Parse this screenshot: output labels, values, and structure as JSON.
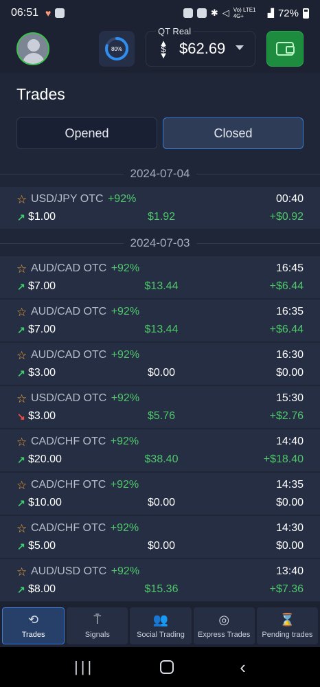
{
  "status_bar": {
    "time": "06:51",
    "battery": "72%",
    "signal_text": "Vo) LTE1 4G+"
  },
  "header": {
    "progress_label": "80%",
    "progress_value": 0.8,
    "account_label": "QT Real",
    "balance": "$62.69"
  },
  "page": {
    "title": "Trades",
    "tabs": {
      "opened": "Opened",
      "closed": "Closed"
    }
  },
  "groups": [
    {
      "date": "2024-07-04",
      "trades": [
        {
          "pair": "USD/JPY OTC",
          "pct": "+92%",
          "time": "00:40",
          "direction": "up",
          "amount": "$1.00",
          "payout": "$1.92",
          "payout_color": "green",
          "profit": "+$0.92",
          "profit_color": "green"
        }
      ]
    },
    {
      "date": "2024-07-03",
      "trades": [
        {
          "pair": "AUD/CAD OTC",
          "pct": "+92%",
          "time": "16:45",
          "direction": "up",
          "amount": "$7.00",
          "payout": "$13.44",
          "payout_color": "green",
          "profit": "+$6.44",
          "profit_color": "green"
        },
        {
          "pair": "AUD/CAD OTC",
          "pct": "+92%",
          "time": "16:35",
          "direction": "up",
          "amount": "$7.00",
          "payout": "$13.44",
          "payout_color": "green",
          "profit": "+$6.44",
          "profit_color": "green"
        },
        {
          "pair": "AUD/CAD OTC",
          "pct": "+92%",
          "time": "16:30",
          "direction": "up",
          "amount": "$3.00",
          "payout": "$0.00",
          "payout_color": "white",
          "profit": "$0.00",
          "profit_color": "white"
        },
        {
          "pair": "USD/CAD OTC",
          "pct": "+92%",
          "time": "15:30",
          "direction": "down",
          "amount": "$3.00",
          "payout": "$5.76",
          "payout_color": "green",
          "profit": "+$2.76",
          "profit_color": "green"
        },
        {
          "pair": "CAD/CHF OTC",
          "pct": "+92%",
          "time": "14:40",
          "direction": "up",
          "amount": "$20.00",
          "payout": "$38.40",
          "payout_color": "green",
          "profit": "+$18.40",
          "profit_color": "green"
        },
        {
          "pair": "CAD/CHF OTC",
          "pct": "+92%",
          "time": "14:35",
          "direction": "up",
          "amount": "$10.00",
          "payout": "$0.00",
          "payout_color": "white",
          "profit": "$0.00",
          "profit_color": "white"
        },
        {
          "pair": "CAD/CHF OTC",
          "pct": "+92%",
          "time": "14:30",
          "direction": "up",
          "amount": "$5.00",
          "payout": "$0.00",
          "payout_color": "white",
          "profit": "$0.00",
          "profit_color": "white"
        },
        {
          "pair": "AUD/USD OTC",
          "pct": "+92%",
          "time": "13:40",
          "direction": "up",
          "amount": "$8.00",
          "payout": "$15.36",
          "payout_color": "green",
          "profit": "+$7.36",
          "profit_color": "green"
        }
      ]
    }
  ],
  "bottom_nav": [
    {
      "label": "Trades",
      "icon": "history-icon",
      "active": true
    },
    {
      "label": "Signals",
      "icon": "antenna-icon",
      "active": false
    },
    {
      "label": "Social Trading",
      "icon": "people-icon",
      "active": false
    },
    {
      "label": "Express Trades",
      "icon": "target-icon",
      "active": false
    },
    {
      "label": "Pending trades",
      "icon": "hourglass-icon",
      "active": false
    }
  ],
  "colors": {
    "accent": "#3a7bd5",
    "positive": "#4fc86a",
    "negative": "#ff4b3a",
    "star": "#f0a030",
    "wallet": "#1e8c3e"
  }
}
